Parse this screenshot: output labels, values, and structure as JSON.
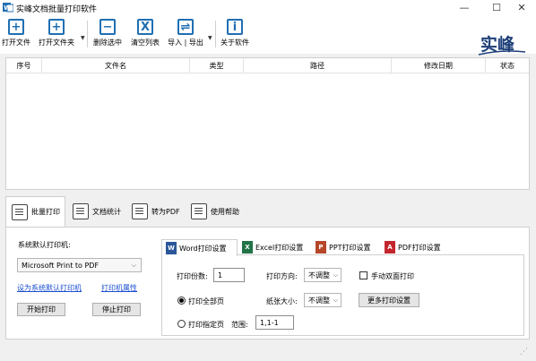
{
  "window": {
    "title": "实峰文档批量打印软件",
    "minimize_glyph": "—",
    "maximize_glyph": "☐",
    "close_glyph": "✕"
  },
  "toolbar": {
    "open_file": "打开文件",
    "open_folder": "打开文件夹",
    "delete_selected": "删除选中",
    "clear_list": "清空列表",
    "import_export": "导入 | 导出",
    "about": "关于软件",
    "icons": {
      "open_file": "plus-file-icon",
      "open_folder": "plus-folder-icon",
      "delete_selected": "minus-icon",
      "clear_list": "x-icon",
      "import_export": "swap-arrows-icon",
      "about": "info-icon"
    }
  },
  "brand": {
    "text": "实峰",
    "color": "#1d3f78"
  },
  "file_table": {
    "columns": [
      "序号",
      "文件名",
      "类型",
      "路径",
      "修改日期",
      "状态"
    ],
    "rows": []
  },
  "main_tabs": [
    {
      "label": "批量打印",
      "active": true
    },
    {
      "label": "文档统计",
      "active": false
    },
    {
      "label": "转为PDF",
      "active": false
    },
    {
      "label": "使用帮助",
      "active": false
    }
  ],
  "printer": {
    "label": "系统默认打印机:",
    "selected": "Microsoft Print to PDF",
    "set_default_link": "设为系统默认打印机",
    "properties_link": "打印机属性",
    "start_button": "开始打印",
    "stop_button": "停止打印"
  },
  "settings_tabs": [
    {
      "label": "Word打印设置",
      "badge": "W",
      "color": "#2b579a",
      "active": true
    },
    {
      "label": "Excel打印设置",
      "badge": "X",
      "color": "#217346",
      "active": false
    },
    {
      "label": "PPT打印设置",
      "badge": "P",
      "color": "#b7472a",
      "active": false
    },
    {
      "label": "PDF打印设置",
      "badge": "A",
      "color": "#c4262e",
      "active": false
    }
  ],
  "word_settings": {
    "copies_label": "打印份数:",
    "copies_value": "1",
    "orientation_label": "打印方向:",
    "orientation_value": "不调整",
    "duplex_label": "手动双面打印",
    "duplex_checked": false,
    "print_all_label": "打印全部页",
    "print_all_selected": true,
    "paper_label": "纸张大小:",
    "paper_value": "不调整",
    "more_settings": "更多打印设置",
    "print_range_label": "打印指定页",
    "print_range_selected": false,
    "range_label": "范围:",
    "range_value": "1,1-1"
  }
}
